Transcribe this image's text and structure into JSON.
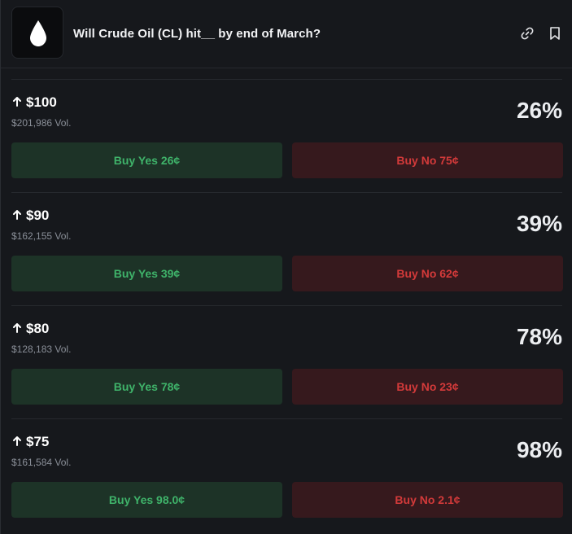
{
  "header": {
    "title": "Will Crude Oil (CL) hit__ by end of March?",
    "logo_icon": "oil-drop-icon",
    "actions": [
      "link-icon",
      "bookmark-icon"
    ]
  },
  "colors": {
    "background": "#16181c",
    "yes_bg": "#1d3327",
    "yes_text": "#3fb36a",
    "no_bg": "#36191d",
    "no_text": "#d33a3a"
  },
  "markets": [
    {
      "direction_icon": "arrow-up-icon",
      "level": "$100",
      "volume": "$201,986 Vol.",
      "probability": "26%",
      "yes_label": "Buy Yes 26¢",
      "no_label": "Buy No 75¢"
    },
    {
      "direction_icon": "arrow-up-icon",
      "level": "$90",
      "volume": "$162,155 Vol.",
      "probability": "39%",
      "yes_label": "Buy Yes 39¢",
      "no_label": "Buy No 62¢"
    },
    {
      "direction_icon": "arrow-up-icon",
      "level": "$80",
      "volume": "$128,183 Vol.",
      "probability": "78%",
      "yes_label": "Buy Yes 78¢",
      "no_label": "Buy No 23¢"
    },
    {
      "direction_icon": "arrow-up-icon",
      "level": "$75",
      "volume": "$161,584 Vol.",
      "probability": "98%",
      "yes_label": "Buy Yes 98.0¢",
      "no_label": "Buy No 2.1¢"
    }
  ]
}
